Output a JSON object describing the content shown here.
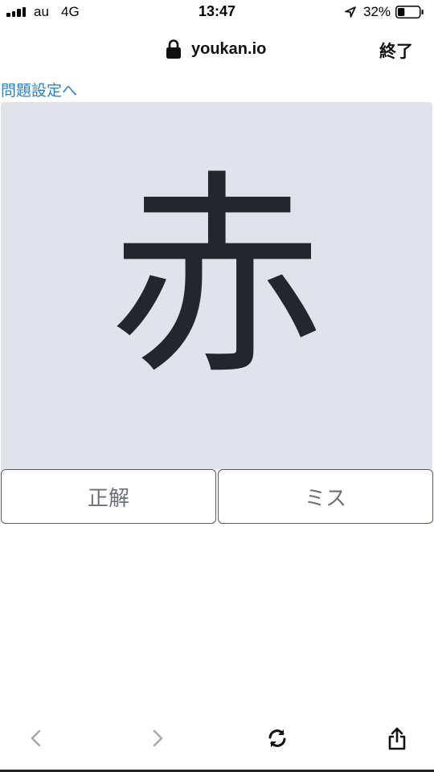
{
  "status_bar": {
    "carrier": "au",
    "network": "4G",
    "time": "13:47",
    "battery_percent": "32%",
    "battery_level": 0.32
  },
  "browser": {
    "url": "youkan.io",
    "done_label": "終了"
  },
  "page": {
    "settings_link": "問題設定へ",
    "card_word": "赤",
    "correct_label": "正解",
    "miss_label": "ミス"
  },
  "toolbar": {
    "back_icon": "chevron-left-icon",
    "forward_icon": "chevron-right-icon",
    "reload_icon": "reload-icon",
    "share_icon": "share-icon"
  },
  "colors": {
    "link": "#2c82c9",
    "card_background": "#e0e3ec",
    "card_text": "#24262b",
    "button_border": "#555a62",
    "button_text": "#6c7178"
  }
}
